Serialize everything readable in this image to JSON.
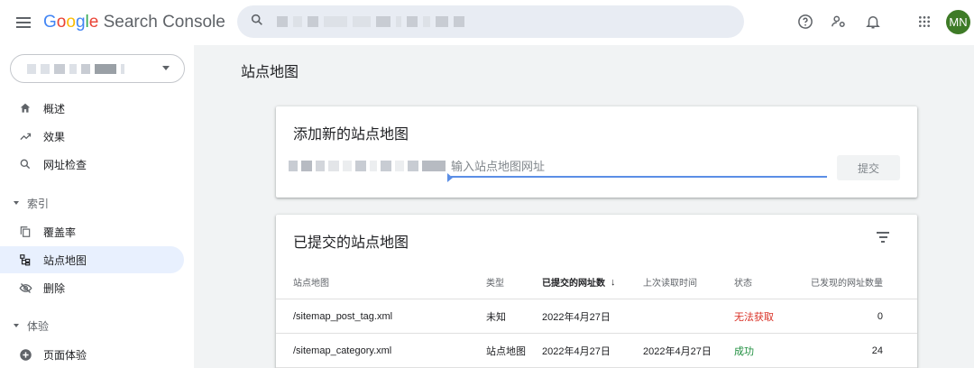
{
  "header": {
    "brand_google": [
      "G",
      "o",
      "o",
      "g",
      "l",
      "e"
    ],
    "brand_product": "Search Console"
  },
  "sidebar": {
    "items_top": [
      {
        "label": "概述",
        "icon": "home-icon"
      },
      {
        "label": "效果",
        "icon": "trending-up-icon"
      },
      {
        "label": "网址检查",
        "icon": "search-icon"
      }
    ],
    "section_index": "索引",
    "items_index": [
      {
        "label": "覆盖率",
        "icon": "copy-icon"
      },
      {
        "label": "站点地图",
        "icon": "sitemap-icon"
      },
      {
        "label": "删除",
        "icon": "visibility-off-icon"
      }
    ],
    "section_experience": "体验",
    "items_experience": [
      {
        "label": "页面体验",
        "icon": "add-circle-icon"
      }
    ]
  },
  "main": {
    "page_title": "站点地图",
    "add_card": {
      "title": "添加新的站点地图",
      "placeholder": "输入站点地图网址",
      "submit_label": "提交"
    },
    "submitted_card": {
      "title": "已提交的站点地图",
      "columns": [
        "站点地图",
        "类型",
        "已提交的网址数",
        "上次读取时间",
        "状态",
        "已发现的网址数量"
      ],
      "rows": [
        {
          "sitemap": "/sitemap_post_tag.xml",
          "type": "未知",
          "submitted": "2022年4月27日",
          "last_read": "",
          "status": "无法获取",
          "discovered": "0"
        },
        {
          "sitemap": "/sitemap_category.xml",
          "type": "站点地图",
          "submitted": "2022年4月27日",
          "last_read": "2022年4月27日",
          "status": "成功",
          "discovered": "24"
        }
      ]
    }
  },
  "user": {
    "initials": "MN",
    "avatar_color": "#3e7b27"
  },
  "colors": {
    "accent": "#1a73e8",
    "active_bg": "#e8f0fe",
    "error": "#d93025",
    "success": "#1e8e3e"
  }
}
